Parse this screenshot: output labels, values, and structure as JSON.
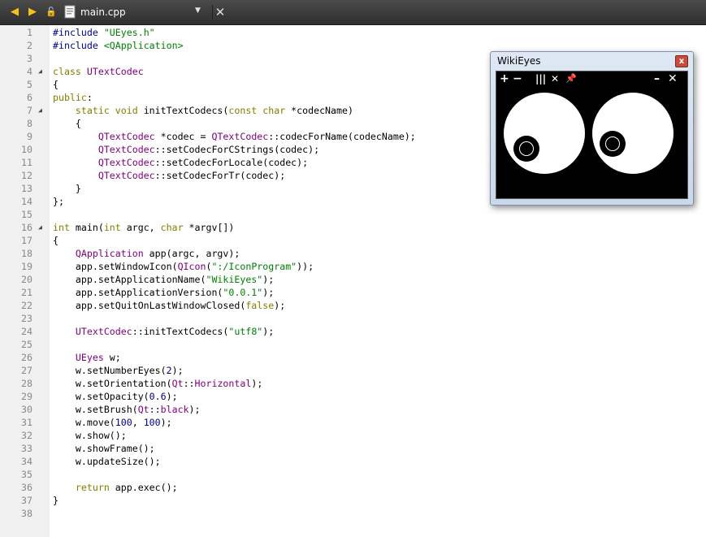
{
  "toolbar": {
    "filename": "main.cpp"
  },
  "code": {
    "lines": [
      {
        "n": "1",
        "fold": "",
        "segs": [
          [
            "nm",
            "#include "
          ],
          [
            "st",
            "\"UEyes.h\""
          ]
        ]
      },
      {
        "n": "2",
        "fold": "",
        "segs": [
          [
            "nm",
            "#include "
          ],
          [
            "st",
            "<QApplication>"
          ]
        ]
      },
      {
        "n": "3",
        "fold": "",
        "segs": []
      },
      {
        "n": "4",
        "fold": "◢",
        "segs": [
          [
            "kw",
            "class "
          ],
          [
            "ty",
            "UTextCodec"
          ]
        ]
      },
      {
        "n": "5",
        "fold": "",
        "segs": [
          [
            "",
            "{"
          ]
        ]
      },
      {
        "n": "6",
        "fold": "",
        "segs": [
          [
            "kw",
            "public"
          ],
          [
            "",
            ""
          ],
          [
            "",
            ":"
          ]
        ]
      },
      {
        "n": "7",
        "fold": "◢",
        "segs": [
          [
            "",
            "    "
          ],
          [
            "kw",
            "static void "
          ],
          [
            "",
            "initTextCodecs("
          ],
          [
            "kw",
            "const char "
          ],
          [
            "",
            "*codecName)"
          ]
        ]
      },
      {
        "n": "8",
        "fold": "",
        "segs": [
          [
            "",
            "    {"
          ]
        ]
      },
      {
        "n": "9",
        "fold": "",
        "segs": [
          [
            "",
            "        "
          ],
          [
            "ty",
            "QTextCodec"
          ],
          [
            "",
            " *codec = "
          ],
          [
            "ty",
            "QTextCodec"
          ],
          [
            "",
            "::codecForName(codecName);"
          ]
        ]
      },
      {
        "n": "10",
        "fold": "",
        "segs": [
          [
            "",
            "        "
          ],
          [
            "ty",
            "QTextCodec"
          ],
          [
            "",
            "::setCodecForCStrings(codec);"
          ]
        ]
      },
      {
        "n": "11",
        "fold": "",
        "segs": [
          [
            "",
            "        "
          ],
          [
            "ty",
            "QTextCodec"
          ],
          [
            "",
            "::setCodecForLocale(codec);"
          ]
        ]
      },
      {
        "n": "12",
        "fold": "",
        "segs": [
          [
            "",
            "        "
          ],
          [
            "ty",
            "QTextCodec"
          ],
          [
            "",
            "::setCodecForTr(codec);"
          ]
        ]
      },
      {
        "n": "13",
        "fold": "",
        "segs": [
          [
            "",
            "    }"
          ]
        ]
      },
      {
        "n": "14",
        "fold": "",
        "segs": [
          [
            "",
            "};"
          ]
        ]
      },
      {
        "n": "15",
        "fold": "",
        "segs": []
      },
      {
        "n": "16",
        "fold": "◢",
        "segs": [
          [
            "kw",
            "int "
          ],
          [
            "",
            "main("
          ],
          [
            "kw",
            "int "
          ],
          [
            "",
            "argc, "
          ],
          [
            "kw",
            "char "
          ],
          [
            "",
            "*argv[])"
          ]
        ]
      },
      {
        "n": "17",
        "fold": "",
        "segs": [
          [
            "",
            "{"
          ]
        ]
      },
      {
        "n": "18",
        "fold": "",
        "segs": [
          [
            "",
            "    "
          ],
          [
            "ty",
            "QApplication"
          ],
          [
            "",
            " app(argc, argv);"
          ]
        ]
      },
      {
        "n": "19",
        "fold": "",
        "segs": [
          [
            "",
            "    app.setWindowIcon("
          ],
          [
            "ty",
            "QIcon"
          ],
          [
            "",
            "("
          ],
          [
            "st",
            "\":/IconProgram\""
          ],
          [
            "",
            "));"
          ]
        ]
      },
      {
        "n": "20",
        "fold": "",
        "segs": [
          [
            "",
            "    app.setApplicationName("
          ],
          [
            "st",
            "\"WikiEyes\""
          ],
          [
            "",
            ");"
          ]
        ]
      },
      {
        "n": "21",
        "fold": "",
        "segs": [
          [
            "",
            "    app.setApplicationVersion("
          ],
          [
            "st",
            "\"0.0.1\""
          ],
          [
            "",
            ");"
          ]
        ]
      },
      {
        "n": "22",
        "fold": "",
        "segs": [
          [
            "",
            "    app.setQuitOnLastWindowClosed("
          ],
          [
            "kw",
            "false"
          ],
          [
            "",
            ");"
          ]
        ]
      },
      {
        "n": "23",
        "fold": "",
        "segs": []
      },
      {
        "n": "24",
        "fold": "",
        "segs": [
          [
            "",
            "    "
          ],
          [
            "ty",
            "UTextCodec"
          ],
          [
            "",
            "::initTextCodecs("
          ],
          [
            "st",
            "\"utf8\""
          ],
          [
            "",
            ");"
          ]
        ]
      },
      {
        "n": "25",
        "fold": "",
        "segs": []
      },
      {
        "n": "26",
        "fold": "",
        "segs": [
          [
            "",
            "    "
          ],
          [
            "ty",
            "UEyes"
          ],
          [
            "",
            " w;"
          ]
        ]
      },
      {
        "n": "27",
        "fold": "",
        "segs": [
          [
            "",
            "    w.setNumberEyes("
          ],
          [
            "nm",
            "2"
          ],
          [
            "",
            ");"
          ]
        ]
      },
      {
        "n": "28",
        "fold": "",
        "segs": [
          [
            "",
            "    w.setOrientation("
          ],
          [
            "ty",
            "Qt"
          ],
          [
            "",
            "::"
          ],
          [
            "ty",
            "Horizontal"
          ],
          [
            "",
            ");"
          ]
        ]
      },
      {
        "n": "29",
        "fold": "",
        "segs": [
          [
            "",
            "    w.setOpacity("
          ],
          [
            "nm",
            "0.6"
          ],
          [
            "",
            ");"
          ]
        ]
      },
      {
        "n": "30",
        "fold": "",
        "segs": [
          [
            "",
            "    w.setBrush("
          ],
          [
            "ty",
            "Qt"
          ],
          [
            "",
            "::"
          ],
          [
            "ty",
            "black"
          ],
          [
            "",
            ");"
          ]
        ]
      },
      {
        "n": "31",
        "fold": "",
        "segs": [
          [
            "",
            "    w.move("
          ],
          [
            "nm",
            "100"
          ],
          [
            "",
            ", "
          ],
          [
            "nm",
            "100"
          ],
          [
            "",
            ");"
          ]
        ]
      },
      {
        "n": "32",
        "fold": "",
        "segs": [
          [
            "",
            "    w.show();"
          ]
        ]
      },
      {
        "n": "33",
        "fold": "",
        "segs": [
          [
            "",
            "    w.showFrame();"
          ]
        ]
      },
      {
        "n": "34",
        "fold": "",
        "segs": [
          [
            "",
            "    w.updateSize();"
          ]
        ]
      },
      {
        "n": "35",
        "fold": "",
        "segs": []
      },
      {
        "n": "36",
        "fold": "",
        "segs": [
          [
            "",
            "    "
          ],
          [
            "kw",
            "return "
          ],
          [
            "",
            "app.exec();"
          ]
        ]
      },
      {
        "n": "37",
        "fold": "",
        "segs": [
          [
            "",
            "}"
          ]
        ]
      },
      {
        "n": "38",
        "fold": "",
        "segs": []
      }
    ]
  },
  "wikieyes": {
    "title": "WikiEyes",
    "close_glyph": "x",
    "buttons": {
      "plus": "+",
      "minus": "−",
      "columns": "|||",
      "tools": "✕",
      "pin": "📌",
      "minimize": "–",
      "close": "✕"
    }
  }
}
